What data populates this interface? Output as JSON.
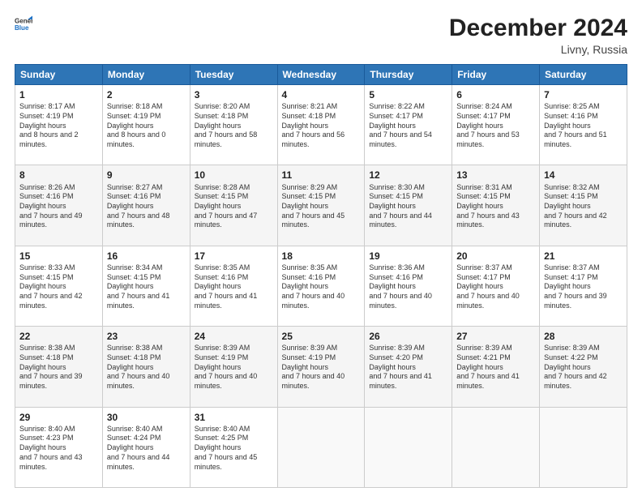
{
  "logo": {
    "general": "General",
    "blue": "Blue"
  },
  "title": "December 2024",
  "location": "Livny, Russia",
  "weekdays": [
    "Sunday",
    "Monday",
    "Tuesday",
    "Wednesday",
    "Thursday",
    "Friday",
    "Saturday"
  ],
  "weeks": [
    [
      {
        "day": "1",
        "sunrise": "8:17 AM",
        "sunset": "4:19 PM",
        "daylight": "8 hours and 2 minutes."
      },
      {
        "day": "2",
        "sunrise": "8:18 AM",
        "sunset": "4:19 PM",
        "daylight": "8 hours and 0 minutes."
      },
      {
        "day": "3",
        "sunrise": "8:20 AM",
        "sunset": "4:18 PM",
        "daylight": "7 hours and 58 minutes."
      },
      {
        "day": "4",
        "sunrise": "8:21 AM",
        "sunset": "4:18 PM",
        "daylight": "7 hours and 56 minutes."
      },
      {
        "day": "5",
        "sunrise": "8:22 AM",
        "sunset": "4:17 PM",
        "daylight": "7 hours and 54 minutes."
      },
      {
        "day": "6",
        "sunrise": "8:24 AM",
        "sunset": "4:17 PM",
        "daylight": "7 hours and 53 minutes."
      },
      {
        "day": "7",
        "sunrise": "8:25 AM",
        "sunset": "4:16 PM",
        "daylight": "7 hours and 51 minutes."
      }
    ],
    [
      {
        "day": "8",
        "sunrise": "8:26 AM",
        "sunset": "4:16 PM",
        "daylight": "7 hours and 49 minutes."
      },
      {
        "day": "9",
        "sunrise": "8:27 AM",
        "sunset": "4:16 PM",
        "daylight": "7 hours and 48 minutes."
      },
      {
        "day": "10",
        "sunrise": "8:28 AM",
        "sunset": "4:15 PM",
        "daylight": "7 hours and 47 minutes."
      },
      {
        "day": "11",
        "sunrise": "8:29 AM",
        "sunset": "4:15 PM",
        "daylight": "7 hours and 45 minutes."
      },
      {
        "day": "12",
        "sunrise": "8:30 AM",
        "sunset": "4:15 PM",
        "daylight": "7 hours and 44 minutes."
      },
      {
        "day": "13",
        "sunrise": "8:31 AM",
        "sunset": "4:15 PM",
        "daylight": "7 hours and 43 minutes."
      },
      {
        "day": "14",
        "sunrise": "8:32 AM",
        "sunset": "4:15 PM",
        "daylight": "7 hours and 42 minutes."
      }
    ],
    [
      {
        "day": "15",
        "sunrise": "8:33 AM",
        "sunset": "4:15 PM",
        "daylight": "7 hours and 42 minutes."
      },
      {
        "day": "16",
        "sunrise": "8:34 AM",
        "sunset": "4:15 PM",
        "daylight": "7 hours and 41 minutes."
      },
      {
        "day": "17",
        "sunrise": "8:35 AM",
        "sunset": "4:16 PM",
        "daylight": "7 hours and 41 minutes."
      },
      {
        "day": "18",
        "sunrise": "8:35 AM",
        "sunset": "4:16 PM",
        "daylight": "7 hours and 40 minutes."
      },
      {
        "day": "19",
        "sunrise": "8:36 AM",
        "sunset": "4:16 PM",
        "daylight": "7 hours and 40 minutes."
      },
      {
        "day": "20",
        "sunrise": "8:37 AM",
        "sunset": "4:17 PM",
        "daylight": "7 hours and 40 minutes."
      },
      {
        "day": "21",
        "sunrise": "8:37 AM",
        "sunset": "4:17 PM",
        "daylight": "7 hours and 39 minutes."
      }
    ],
    [
      {
        "day": "22",
        "sunrise": "8:38 AM",
        "sunset": "4:18 PM",
        "daylight": "7 hours and 39 minutes."
      },
      {
        "day": "23",
        "sunrise": "8:38 AM",
        "sunset": "4:18 PM",
        "daylight": "7 hours and 40 minutes."
      },
      {
        "day": "24",
        "sunrise": "8:39 AM",
        "sunset": "4:19 PM",
        "daylight": "7 hours and 40 minutes."
      },
      {
        "day": "25",
        "sunrise": "8:39 AM",
        "sunset": "4:19 PM",
        "daylight": "7 hours and 40 minutes."
      },
      {
        "day": "26",
        "sunrise": "8:39 AM",
        "sunset": "4:20 PM",
        "daylight": "7 hours and 41 minutes."
      },
      {
        "day": "27",
        "sunrise": "8:39 AM",
        "sunset": "4:21 PM",
        "daylight": "7 hours and 41 minutes."
      },
      {
        "day": "28",
        "sunrise": "8:39 AM",
        "sunset": "4:22 PM",
        "daylight": "7 hours and 42 minutes."
      }
    ],
    [
      {
        "day": "29",
        "sunrise": "8:40 AM",
        "sunset": "4:23 PM",
        "daylight": "7 hours and 43 minutes."
      },
      {
        "day": "30",
        "sunrise": "8:40 AM",
        "sunset": "4:24 PM",
        "daylight": "7 hours and 44 minutes."
      },
      {
        "day": "31",
        "sunrise": "8:40 AM",
        "sunset": "4:25 PM",
        "daylight": "7 hours and 45 minutes."
      },
      null,
      null,
      null,
      null
    ]
  ],
  "labels": {
    "sunrise": "Sunrise:",
    "sunset": "Sunset:",
    "daylight": "Daylight hours"
  }
}
